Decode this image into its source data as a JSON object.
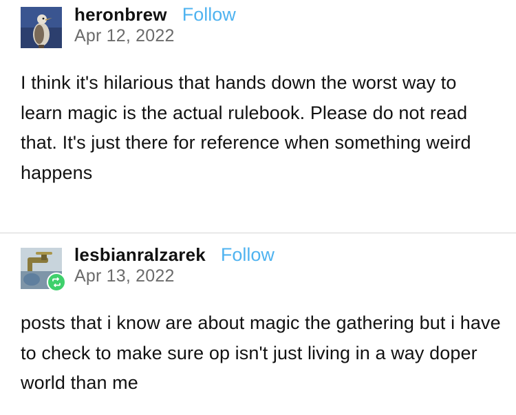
{
  "posts": [
    {
      "username": "heronbrew",
      "follow_label": "Follow",
      "date": "Apr 12, 2022",
      "avatar_icon": "heron-bird-avatar",
      "body": "I think it's hilarious that hands down the worst way to learn magic is the actual rulebook. Please do not read that. It's just there for reference when something weird happens"
    },
    {
      "username": "lesbianralzarek",
      "follow_label": "Follow",
      "date": "Apr 13, 2022",
      "avatar_icon": "faucet-avatar",
      "badge_icon": "reblog-icon",
      "body": "posts that i know are about magic the gathering but i have to check to make sure op isn't just living in a way doper world than me"
    }
  ],
  "colors": {
    "follow": "#4fb3f0",
    "reblog_badge": "#3fd06c",
    "date_text": "#6b6b6b",
    "divider": "#d4d4d4"
  }
}
